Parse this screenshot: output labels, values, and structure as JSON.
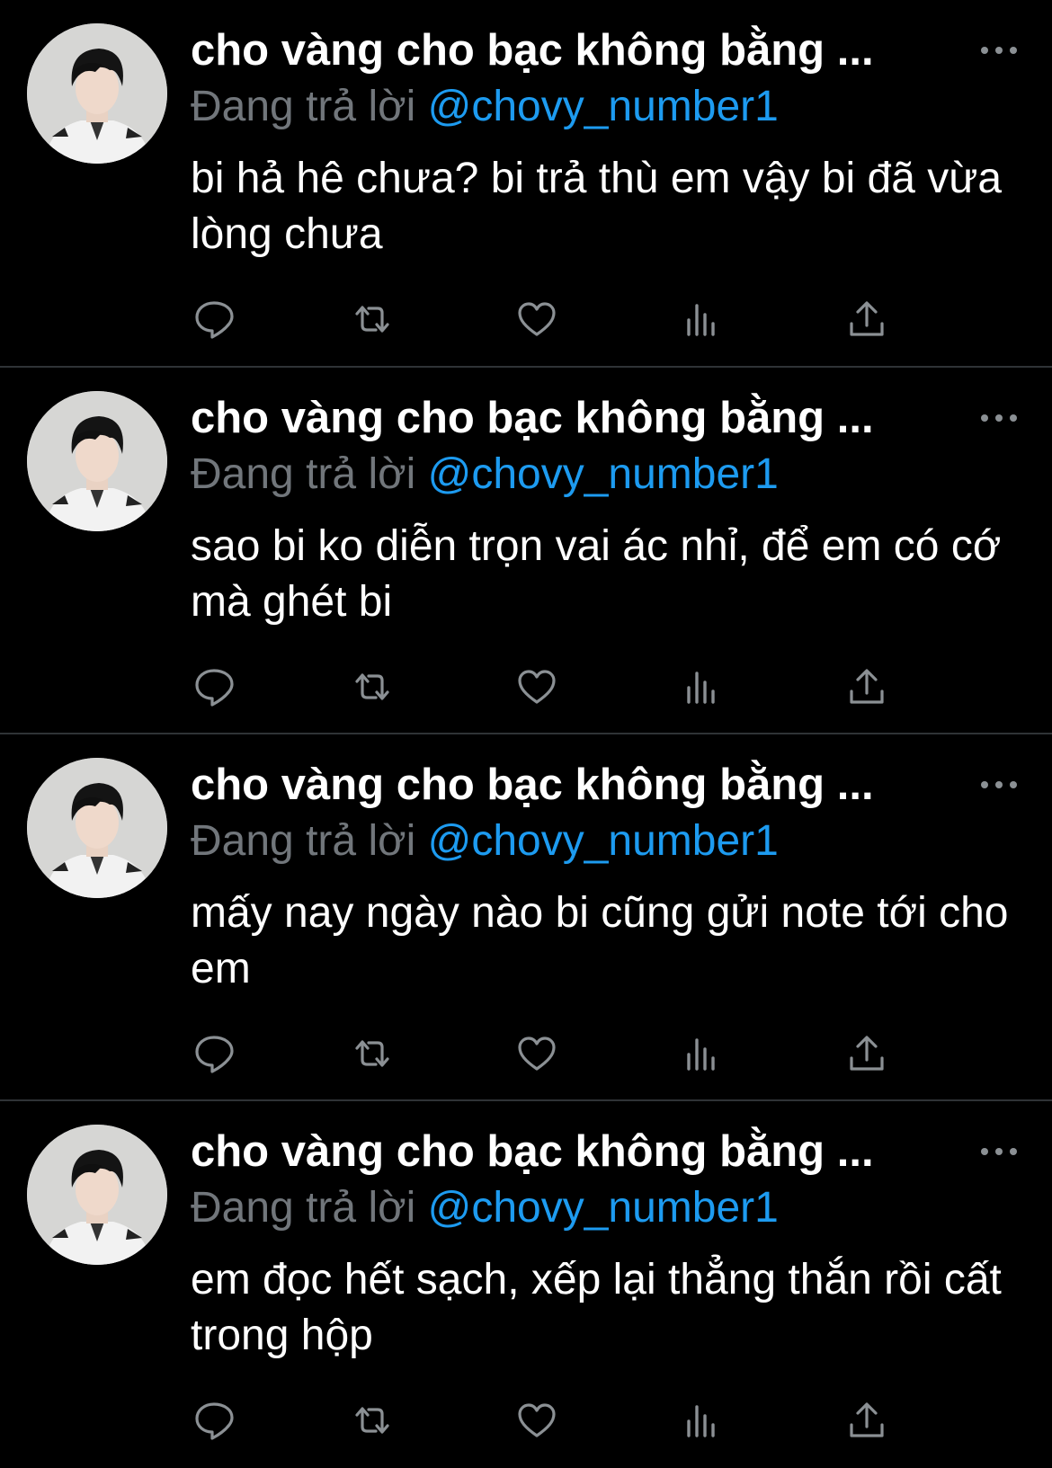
{
  "tweets": [
    {
      "name": "cho vàng cho bạc không bằng ...",
      "replying_label": "Đang trả lời",
      "handle": "@chovy_number1",
      "text": "bi hả hê chưa? bi trả thù em vậy bi đã vừa lòng chưa"
    },
    {
      "name": "cho vàng cho bạc không bằng ...",
      "replying_label": "Đang trả lời",
      "handle": "@chovy_number1",
      "text": "sao bi ko diễn trọn vai ác nhỉ, để em có cớ mà ghét bi"
    },
    {
      "name": "cho vàng cho bạc không bằng ...",
      "replying_label": "Đang trả lời",
      "handle": "@chovy_number1",
      "text": "mấy nay ngày nào bi cũng gửi note tới cho em"
    },
    {
      "name": "cho vàng cho bạc không bằng ...",
      "replying_label": "Đang trả lời",
      "handle": "@chovy_number1",
      "text": "em đọc hết sạch, xếp lại thẳng thắn rồi cất trong hộp"
    }
  ],
  "icons": {
    "more": "more-horizontal-icon",
    "reply": "reply-icon",
    "retweet": "retweet-icon",
    "like": "heart-icon",
    "views": "views-icon",
    "share": "share-icon"
  },
  "colors": {
    "background": "#000000",
    "text": "#ffffff",
    "muted": "#71767b",
    "link": "#1d9bf0",
    "divider": "#2f3336"
  }
}
